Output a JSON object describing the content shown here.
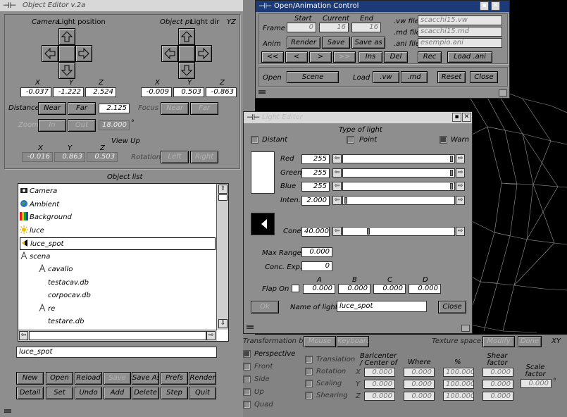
{
  "background_window": {
    "title": "Object Editor v.2a"
  },
  "camera_panel": {
    "label_camera": "Camera",
    "label_light_position": "Light position",
    "label_object_pt": "Object pt",
    "label_light_dir": "Light dir",
    "label_yz": "YZ",
    "pos_axes": [
      "X",
      "Y",
      "Z"
    ],
    "pos_values": [
      "-0.037",
      "-1.222",
      "2.524"
    ],
    "dir_axes": [
      "X",
      "Y",
      "Z"
    ],
    "dir_values": [
      "-0.009",
      "0.503",
      "-0.863"
    ],
    "distance_label": "Distance",
    "near_label": "Near",
    "far_label": "Far",
    "distance_value": "2.125",
    "focus_label": "Focus",
    "focus_near_label": "Near",
    "focus_far_label": "Far",
    "zoom_label": "Zoom",
    "zoom_in_label": "In",
    "zoom_out_label": "Out",
    "zoom_value": "18.000",
    "degree_symbol": "°",
    "view_up_label": "View Up",
    "viewup_axes": [
      "X",
      "Y",
      "Z"
    ],
    "viewup_values": [
      "-0.016",
      "0.863",
      "0.503"
    ],
    "rotation_label": "Rotation",
    "rot_left_label": "Left",
    "rot_right_label": "Right"
  },
  "object_list": {
    "header": "Object list",
    "items": [
      {
        "label": "Camera",
        "icon": "camera-icon"
      },
      {
        "label": "Ambient",
        "icon": "globe-icon"
      },
      {
        "label": "Background",
        "icon": "color-bars-icon"
      },
      {
        "label": "luce",
        "icon": "sun-icon"
      },
      {
        "label": "luce_spot",
        "icon": "spotlight-icon",
        "selected": true
      },
      {
        "label": "scena",
        "icon": "compass-icon"
      },
      {
        "label": "cavallo",
        "icon": "compass-icon"
      },
      {
        "label": "testacav.db",
        "icon": ""
      },
      {
        "label": "corpocav.db",
        "icon": ""
      },
      {
        "label": "re",
        "icon": "compass-icon"
      },
      {
        "label": "testare.db",
        "icon": ""
      }
    ],
    "selected_name": "luce_spot"
  },
  "bottom_buttons": {
    "row1": [
      "New",
      "Open",
      "Reload",
      "Save",
      "Save As",
      "Prefs",
      "Render"
    ],
    "row2": [
      "Detail",
      "Set",
      "Undo",
      "Add",
      "Delete",
      "Step",
      "Quit"
    ]
  },
  "transform_panel": {
    "transformation_by_label": "Transformation by:",
    "mouse_label": "Mouse",
    "keyboard_label": "Keyboard",
    "texture_space_label": "Texture space:",
    "modify_label": "Modify",
    "done_label": "Done",
    "xy_label": "XY",
    "view_options": [
      "Perspective",
      "Front",
      "Side",
      "Up",
      "Quad"
    ],
    "transform_options": [
      "Translation",
      "Rotation",
      "Scaling",
      "Shearing"
    ],
    "col_barycenter": "Baricenter / Center of",
    "col_where": "Where",
    "col_percent": "%",
    "col_shear": "Shear factor",
    "col_scale": "Scale factor",
    "axes": [
      "X",
      "Y",
      "Z"
    ],
    "barycenter_values": [
      "0.000",
      "0.000",
      "0.000"
    ],
    "where_values": [
      "0.000",
      "0.000",
      "0.000"
    ],
    "percent_values": [
      "100.000",
      "100.000",
      "100.000"
    ],
    "shear_values": [
      "0.000",
      "0.000",
      "0.000"
    ],
    "scale_value": "0.000",
    "scale_unit": "°"
  },
  "anim_window": {
    "title": "Open/Animation Control",
    "frame_label": "Frame",
    "start_label": "Start",
    "current_label": "Current",
    "end_label": "End",
    "start_value": "0",
    "current_value": "16",
    "end_value": "16",
    "vw_file_label": ".vw file",
    "vw_file_value": "scacchi15.vw",
    "md_file_label": ".md file",
    "md_file_value": "scacchi15.md",
    "ani_file_label": ".ani file",
    "ani_file_value": "esempio.ani",
    "anim_label": "Anim",
    "render_label": "Render",
    "save_label": "Save",
    "save_as_label": "Save as",
    "nav_buttons": [
      "<<",
      "<",
      ">",
      ">>"
    ],
    "ins_label": "Ins",
    "del_label": "Del",
    "rec_label": "Rec",
    "load_ani_label": "Load .ani",
    "open_label": "Open",
    "scene_label": "Scene",
    "load_label": "Load",
    "vw_label": ".vw",
    "md_label": ".md",
    "reset_label": "Reset",
    "close_label": "Close"
  },
  "light_window": {
    "title": "Light Editor",
    "type_of_light_label": "Type of light",
    "distant_label": "Distant",
    "point_label": "Point",
    "warn_label": "Warn",
    "red_label": "Red",
    "green_label": "Green",
    "blue_label": "Blue",
    "inten_label": "Inten.",
    "red_value": "255",
    "green_value": "255",
    "blue_value": "255",
    "inten_value": "2.000",
    "cone_label": "Cone",
    "cone_value": "40.000",
    "max_range_label": "Max Range",
    "max_range_value": "0.000",
    "conc_exp_label": "Conc. Exp.",
    "conc_exp_value": "0",
    "flap_on_label": "Flap On",
    "flap_cols": [
      "A",
      "B",
      "C",
      "D"
    ],
    "flap_values": [
      "0.000",
      "0.000",
      "0.000",
      "0.000"
    ],
    "ok_label": "Ok",
    "name_of_light_label": "Name of light",
    "name_value": "luce_spot",
    "close_label": "Close",
    "slider_levels": {
      "red": 1.0,
      "green": 1.0,
      "blue": 1.0,
      "inten": 0.01,
      "cone": 0.22
    }
  },
  "colors": {
    "desktop": "#838383",
    "panel": "#8e8e8e",
    "titlebar_active": "#1c3a78",
    "field": "#ffffff",
    "viewport": "#000000"
  }
}
